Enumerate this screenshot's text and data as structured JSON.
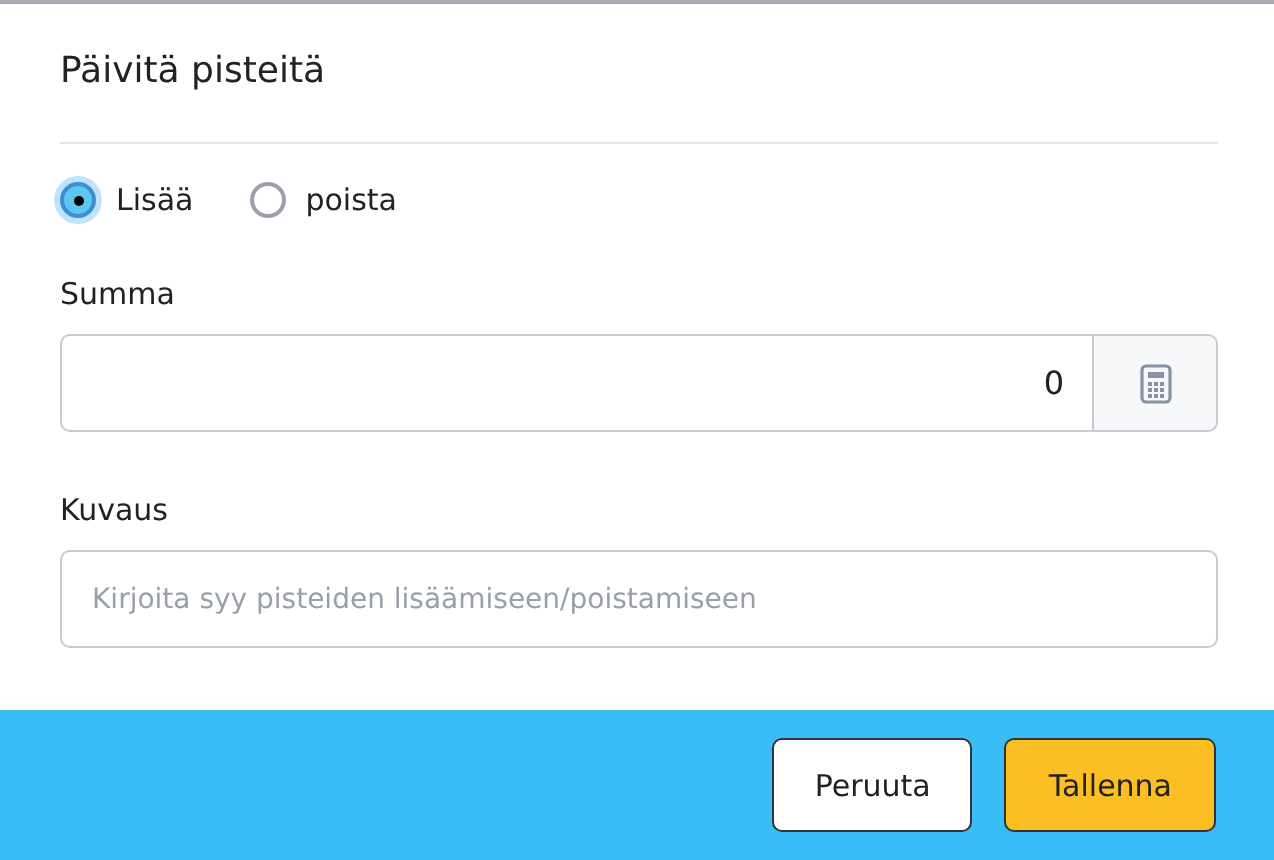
{
  "dialog": {
    "title": "Päivitä pisteitä"
  },
  "mode_options": [
    {
      "label": "Lisää",
      "selected": true
    },
    {
      "label": "poista",
      "selected": false
    }
  ],
  "amount": {
    "label": "Summa",
    "value": "0"
  },
  "description": {
    "label": "Kuvaus",
    "placeholder": "Kirjoita syy pisteiden lisäämiseen/poistamiseen"
  },
  "buttons": [
    {
      "label": "Peruuta",
      "kind": "secondary"
    },
    {
      "label": "Tallenna",
      "kind": "primary"
    }
  ]
}
